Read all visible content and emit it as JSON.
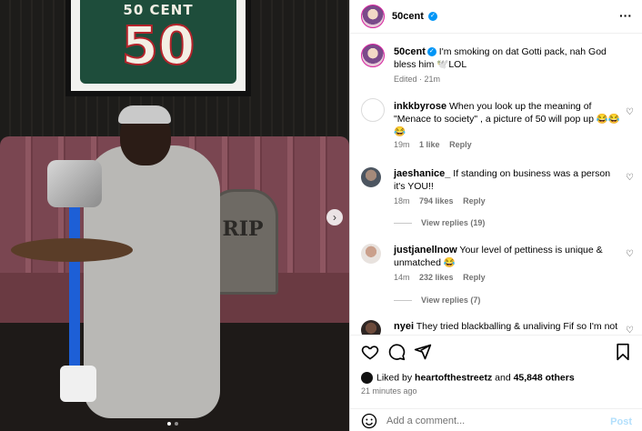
{
  "photo": {
    "jersey_name": "50 CENT",
    "jersey_number": "50",
    "tombstone_text": "RIP",
    "next_glyph": "›",
    "dots_total": 2,
    "dots_active": 1
  },
  "header": {
    "username": "50cent",
    "verified": true,
    "more_glyph": "···"
  },
  "caption": {
    "username": "50cent",
    "text": " I'm smoking on dat Gotti pack, nah God bless him 🕊️LOL",
    "edited": "Edited · 21m"
  },
  "comments": [
    {
      "username": "inkkbyrose",
      "text": "When you look up the meaning of \"Menace to society\" , a picture of 50 will pop up 😂😂😂",
      "time": "19m",
      "likes": "1 like",
      "reply": "Reply",
      "view_replies": ""
    },
    {
      "username": "jaeshanice_",
      "text": "If standing on business was a person it's YOU!!",
      "time": "18m",
      "likes": "794 likes",
      "reply": "Reply",
      "view_replies": "View replies (19)"
    },
    {
      "username": "justjanellnow",
      "text": "Your level of pettiness is unique & unmatched 😂",
      "time": "14m",
      "likes": "232 likes",
      "reply": "Reply",
      "view_replies": "View replies (7)"
    },
    {
      "username": "nyei",
      "text": "They tried blackballing & unaliving Fif so I'm not",
      "time": "",
      "likes": "",
      "reply": "",
      "view_replies": ""
    }
  ],
  "actions": {
    "liked_by_prefix": "Liked by ",
    "liked_by_user": "heartofthestreetz",
    "liked_by_and": " and ",
    "liked_by_count": "45,848 others",
    "time_ago": "21 minutes ago"
  },
  "add_comment": {
    "placeholder": "Add a comment...",
    "post_label": "Post"
  },
  "colors": {
    "verified": "#0095f6",
    "post_disabled": "#b2dffc",
    "secondary_text": "#737373"
  }
}
